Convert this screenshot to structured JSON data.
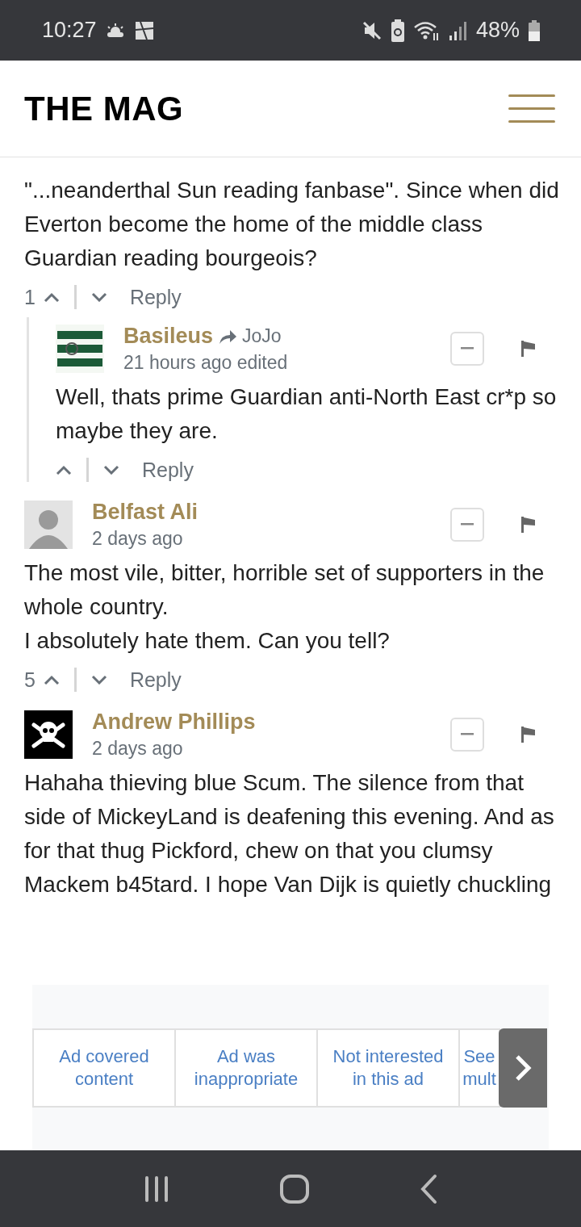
{
  "status_bar": {
    "time": "10:27",
    "battery": "48%"
  },
  "header": {
    "logo": "THE MAG"
  },
  "comments": [
    {
      "kind": "partial",
      "indented": false,
      "body": [
        "\"...neanderthal Sun reading fanbase\". Since when did Everton become the home of the middle class Guardian reading bourgeois?"
      ],
      "votes": "1",
      "reply": "Reply"
    },
    {
      "kind": "full",
      "indented": true,
      "avatar": {
        "kind": "toga"
      },
      "author": "Basileus",
      "reply_to": "JoJo",
      "time": "21 hours ago edited",
      "body": [
        "Well, thats prime Guardian anti-North East cr*p so maybe they are."
      ],
      "reply": "Reply"
    },
    {
      "kind": "full",
      "indented": false,
      "avatar": {
        "kind": "default"
      },
      "author": "Belfast Ali",
      "time": "2 days ago",
      "body": [
        "The most vile, bitter, horrible set of supporters in the whole country.",
        "I absolutely hate them. Can you tell?"
      ],
      "votes": "5",
      "reply": "Reply"
    },
    {
      "kind": "full",
      "indented": false,
      "avatar": {
        "kind": "skull"
      },
      "author": "Andrew Phillips",
      "time": "2 days ago",
      "body": [
        "Hahaha thieving blue Scum. The silence from that side of MickeyLand is deafening this evening. And as for that thug Pickford, chew on that you clumsy Mackem b45tard. I hope Van Dijk is quietly chuckling"
      ]
    }
  ],
  "ad_feedback": {
    "options": [
      "Ad covered content",
      "Ad was inappropriate",
      "Not interested in this ad",
      "See mult"
    ]
  }
}
